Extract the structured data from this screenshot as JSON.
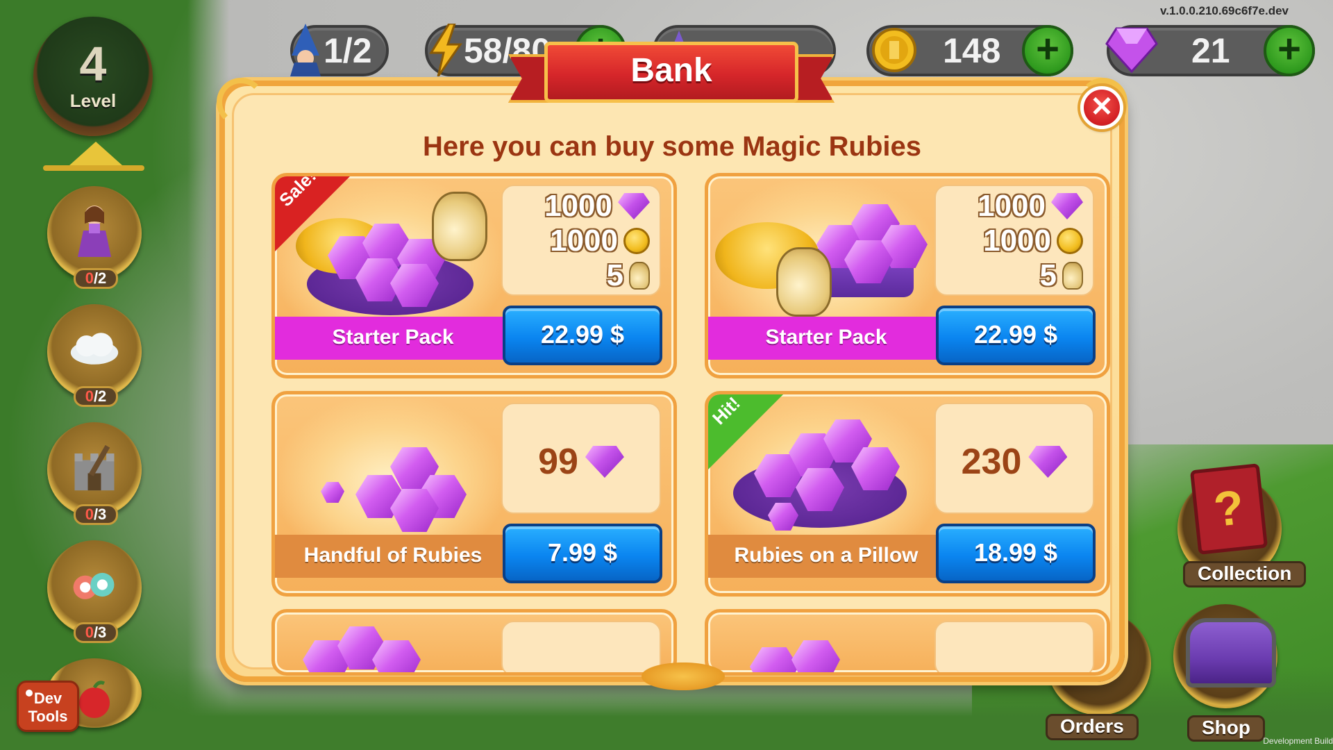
{
  "hud": {
    "level_number": "4",
    "level_label": "Level",
    "resources": {
      "wizards": {
        "value": "1/2",
        "icon": "wizard-icon"
      },
      "energy": {
        "value": "58/80",
        "icon": "lightning-icon"
      },
      "stars": {
        "value": "",
        "icon": "star-icon"
      },
      "coins": {
        "value": "148",
        "icon": "coin-icon"
      },
      "rubies": {
        "value": "21",
        "icon": "ruby-icon"
      }
    },
    "version": "v.1.0.0.210.69c6f7e.dev",
    "dev_build": "Development Build"
  },
  "tasks": [
    {
      "done": "0",
      "total": "/2",
      "icon": "princess-icon"
    },
    {
      "done": "0",
      "total": "/2",
      "icon": "cloud-icon"
    },
    {
      "done": "0",
      "total": "/3",
      "icon": "tower-icon"
    },
    {
      "done": "0",
      "total": "/3",
      "icon": "candy-icon"
    }
  ],
  "dev_tools": "Dev\nTools",
  "side": {
    "collection": "Collection",
    "orders": "Orders",
    "shop": "Shop"
  },
  "bank": {
    "title": "Bank",
    "subtitle": "Here you can buy some Magic Rubies",
    "offers": [
      {
        "tag": "Sale!",
        "name": "Starter Pack",
        "price": "22.99 $",
        "lines": [
          {
            "amount": "1000",
            "icon": "ruby-icon"
          },
          {
            "amount": "1000",
            "icon": "coin-icon"
          },
          {
            "amount": "5",
            "icon": "seed-bag-icon"
          }
        ]
      },
      {
        "tag": "",
        "name": "Starter Pack",
        "price": "22.99 $",
        "lines": [
          {
            "amount": "1000",
            "icon": "ruby-icon"
          },
          {
            "amount": "1000",
            "icon": "coin-icon"
          },
          {
            "amount": "5",
            "icon": "seed-bag-icon"
          }
        ]
      },
      {
        "tag": "",
        "name": "Handful of Rubies",
        "price": "7.99 $",
        "amount": "99",
        "icon": "ruby-icon"
      },
      {
        "tag": "Hit!",
        "name": "Rubies on a Pillow",
        "price": "18.99 $",
        "amount": "230",
        "icon": "ruby-icon"
      }
    ]
  },
  "colors": {
    "ribbon": "#d6262a",
    "price_button": "#0a85f0",
    "starter_label": "#e22cdd",
    "rubies_label": "#e08b3f",
    "sale_tag": "#d92222",
    "hit_tag": "#4cbc2d"
  }
}
